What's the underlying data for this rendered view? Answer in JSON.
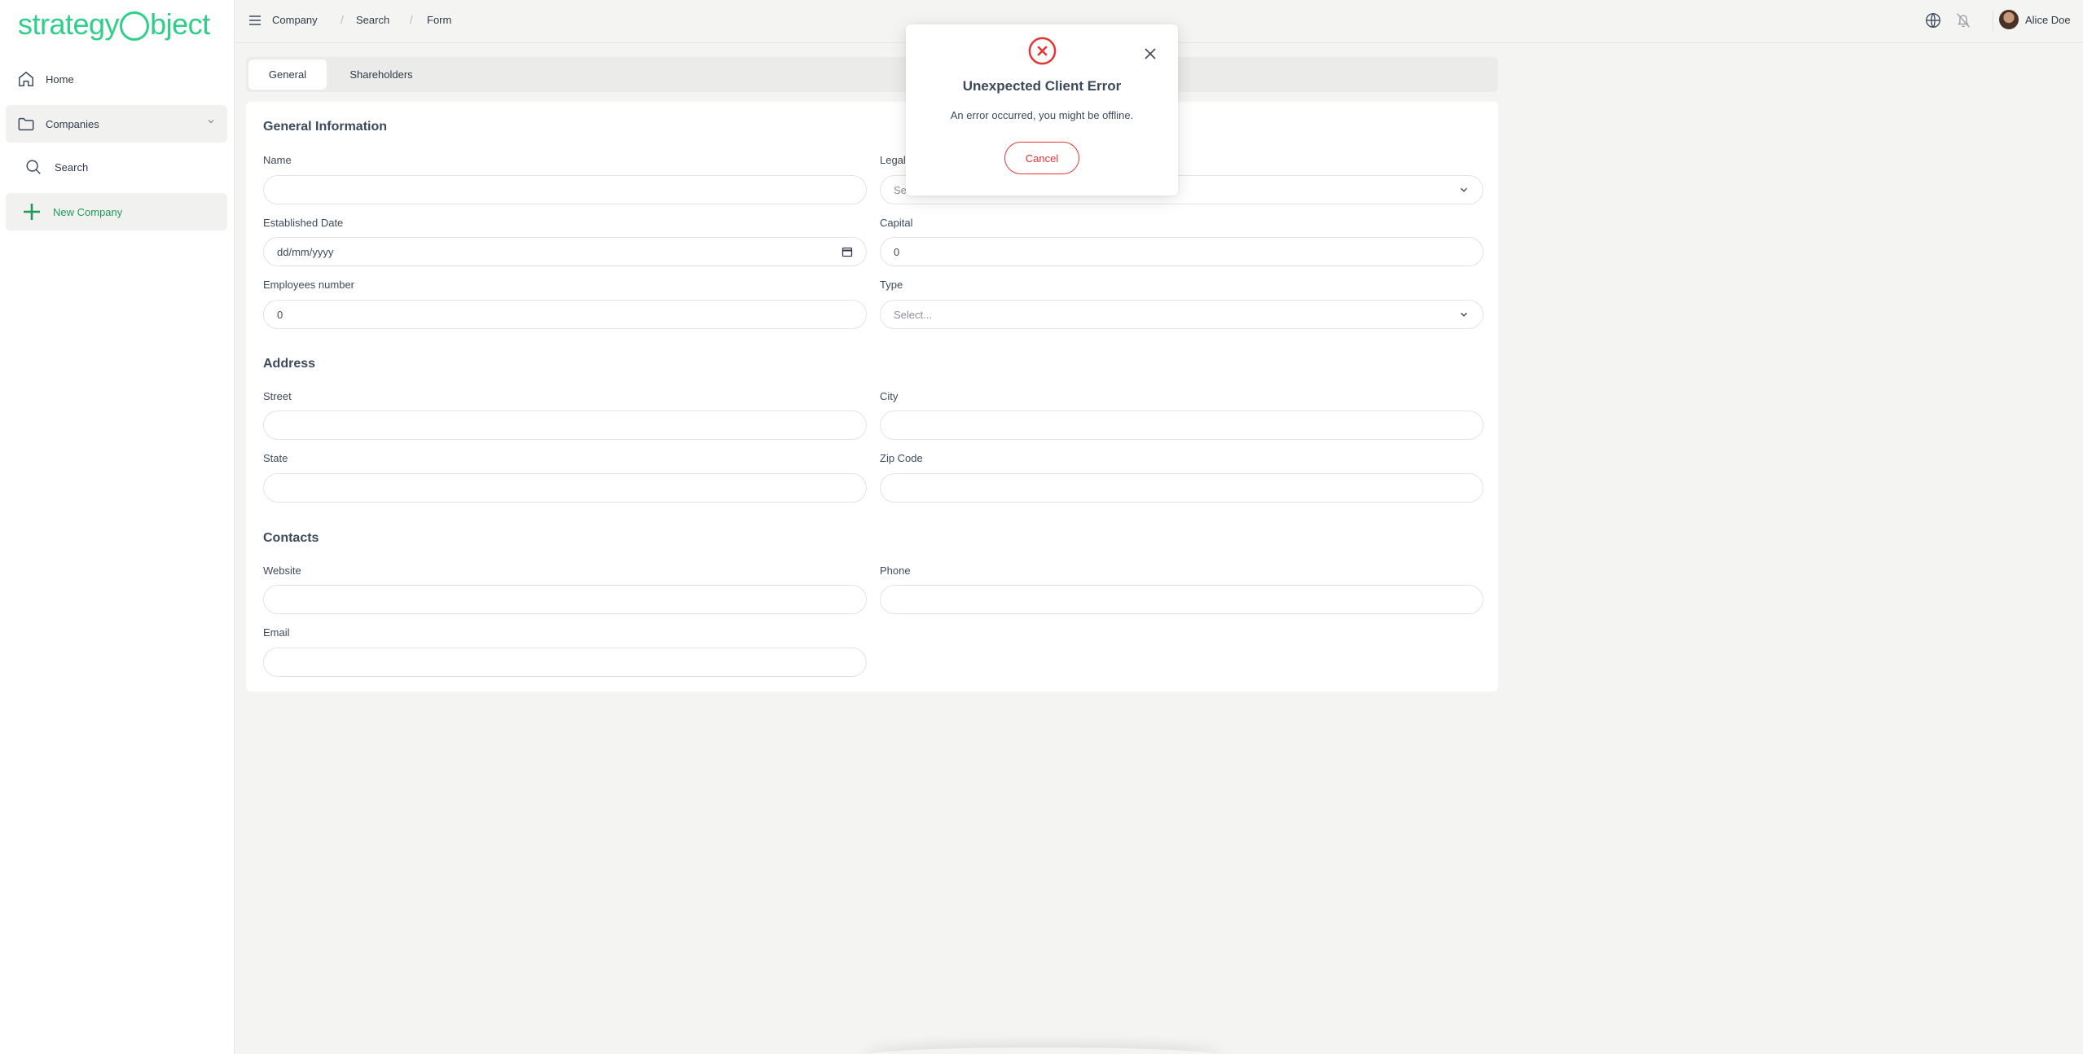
{
  "brand": {
    "logo_pre": "strategy",
    "logo_post": "bject",
    "accent": "#2fcf8a"
  },
  "sidebar": {
    "items": [
      {
        "label": "Home",
        "icon": "home-icon"
      },
      {
        "label": "Companies",
        "icon": "folder-icon"
      },
      {
        "label": "Search",
        "icon": "search-icon"
      },
      {
        "label": "New Company",
        "icon": "plus-icon"
      }
    ]
  },
  "breadcrumb": [
    "Company",
    "Search",
    "Form"
  ],
  "user": {
    "name": "Alice Doe"
  },
  "tabs": [
    {
      "label": "General",
      "active": true
    },
    {
      "label": "Shareholders",
      "active": false
    }
  ],
  "form": {
    "general": {
      "title": "General Information",
      "name": {
        "label": "Name",
        "value": ""
      },
      "legal": {
        "label": "Legal",
        "placeholder": "Se"
      },
      "established_date": {
        "label": "Established Date",
        "placeholder": "dd/mm/yyyy"
      },
      "capital": {
        "label": "Capital",
        "value": "0"
      },
      "employees": {
        "label": "Employees number",
        "value": "0"
      },
      "type": {
        "label": "Type",
        "placeholder": "Select..."
      }
    },
    "address": {
      "title": "Address",
      "street": {
        "label": "Street"
      },
      "city": {
        "label": "City"
      },
      "state": {
        "label": "State"
      },
      "zip": {
        "label": "Zip Code"
      }
    },
    "contacts": {
      "title": "Contacts",
      "website": {
        "label": "Website"
      },
      "phone": {
        "label": "Phone"
      },
      "email": {
        "label": "Email"
      }
    }
  },
  "modal": {
    "title": "Unexpected Client Error",
    "message": "An error occurred, you might be offline.",
    "cancel_label": "Cancel",
    "error_color": "#e53535"
  }
}
